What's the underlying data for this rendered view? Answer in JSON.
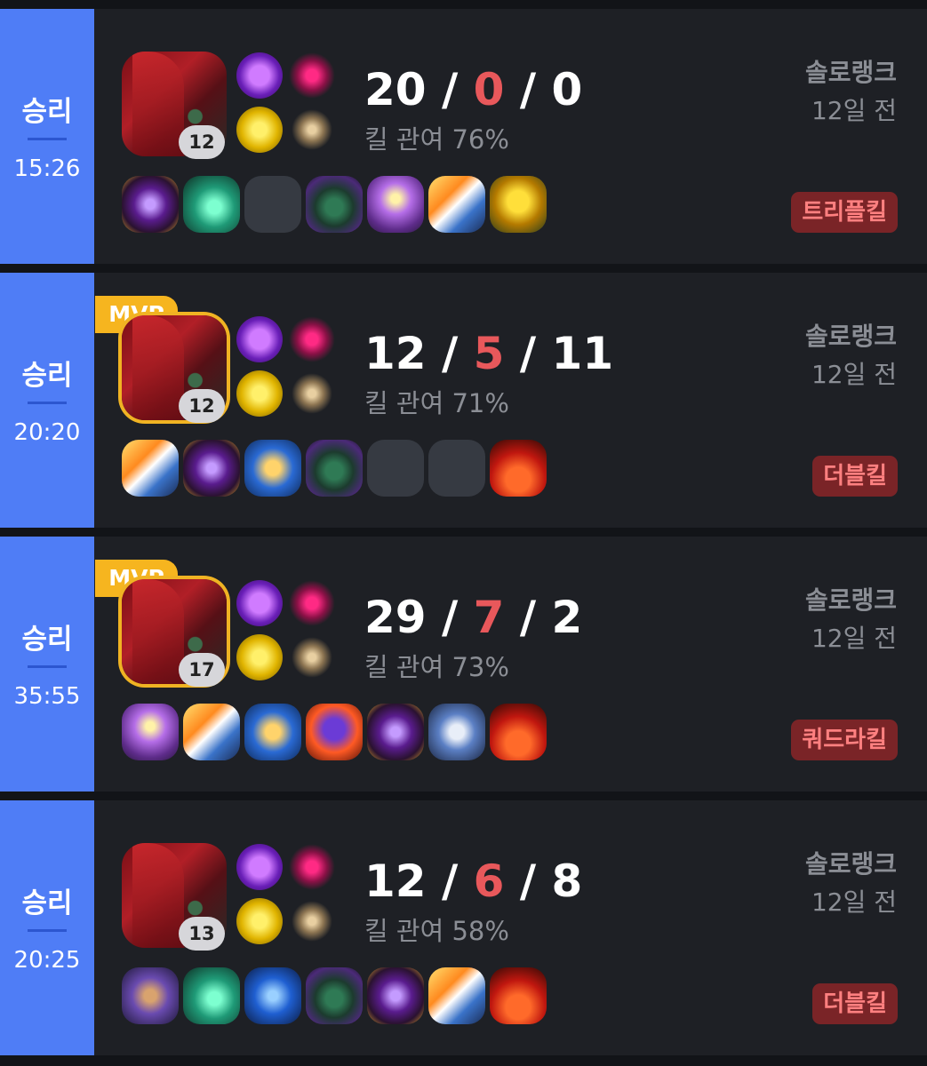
{
  "matches": [
    {
      "result": "승리",
      "duration": "15:26",
      "level": "12",
      "mvp": false,
      "kda": {
        "kills": "20",
        "deaths": "0",
        "assists": "0"
      },
      "kill_participation": "킬 관여 76%",
      "mode": "솔로랭크",
      "time_ago": "12일 전",
      "multikill": "트리플킬",
      "items": [
        "shadow-blade",
        "green-potion",
        "empty",
        "boots",
        "spellbook",
        "sword",
        "golden-flower"
      ]
    },
    {
      "result": "승리",
      "duration": "20:20",
      "level": "12",
      "mvp": true,
      "mvp_label": "MVP",
      "kda": {
        "kills": "12",
        "deaths": "5",
        "assists": "11"
      },
      "kill_participation": "킬 관여 71%",
      "mode": "솔로랭크",
      "time_ago": "12일 전",
      "multikill": "더블킬",
      "items": [
        "sword",
        "shadow-blade",
        "hourglass",
        "boots",
        "empty",
        "empty",
        "red-ward"
      ]
    },
    {
      "result": "승리",
      "duration": "35:55",
      "level": "17",
      "mvp": true,
      "mvp_label": "MVP",
      "kda": {
        "kills": "29",
        "deaths": "7",
        "assists": "2"
      },
      "kill_participation": "킬 관여 73%",
      "mode": "솔로랭크",
      "time_ago": "12일 전",
      "multikill": "쿼드라킬",
      "items": [
        "spellbook",
        "sword",
        "hourglass",
        "wizard-hat",
        "shadow-blade",
        "silver-blade",
        "red-ward"
      ]
    },
    {
      "result": "승리",
      "duration": "20:25",
      "level": "13",
      "mvp": false,
      "kda": {
        "kills": "12",
        "deaths": "6",
        "assists": "8"
      },
      "kill_participation": "킬 관여 58%",
      "mode": "솔로랭크",
      "time_ago": "12일 전",
      "multikill": "더블킬",
      "items": [
        "ring",
        "green-potion",
        "blue-gun",
        "boots",
        "shadow-blade",
        "sword",
        "red-ward"
      ]
    }
  ],
  "colors": {
    "win_accent": "#4f7df6",
    "card_bg": "#1e2025",
    "deaths": "#e8585b",
    "mvp": "#f6b51f",
    "multikill_bg": "#7a2427",
    "multikill_text": "#ff8080"
  }
}
